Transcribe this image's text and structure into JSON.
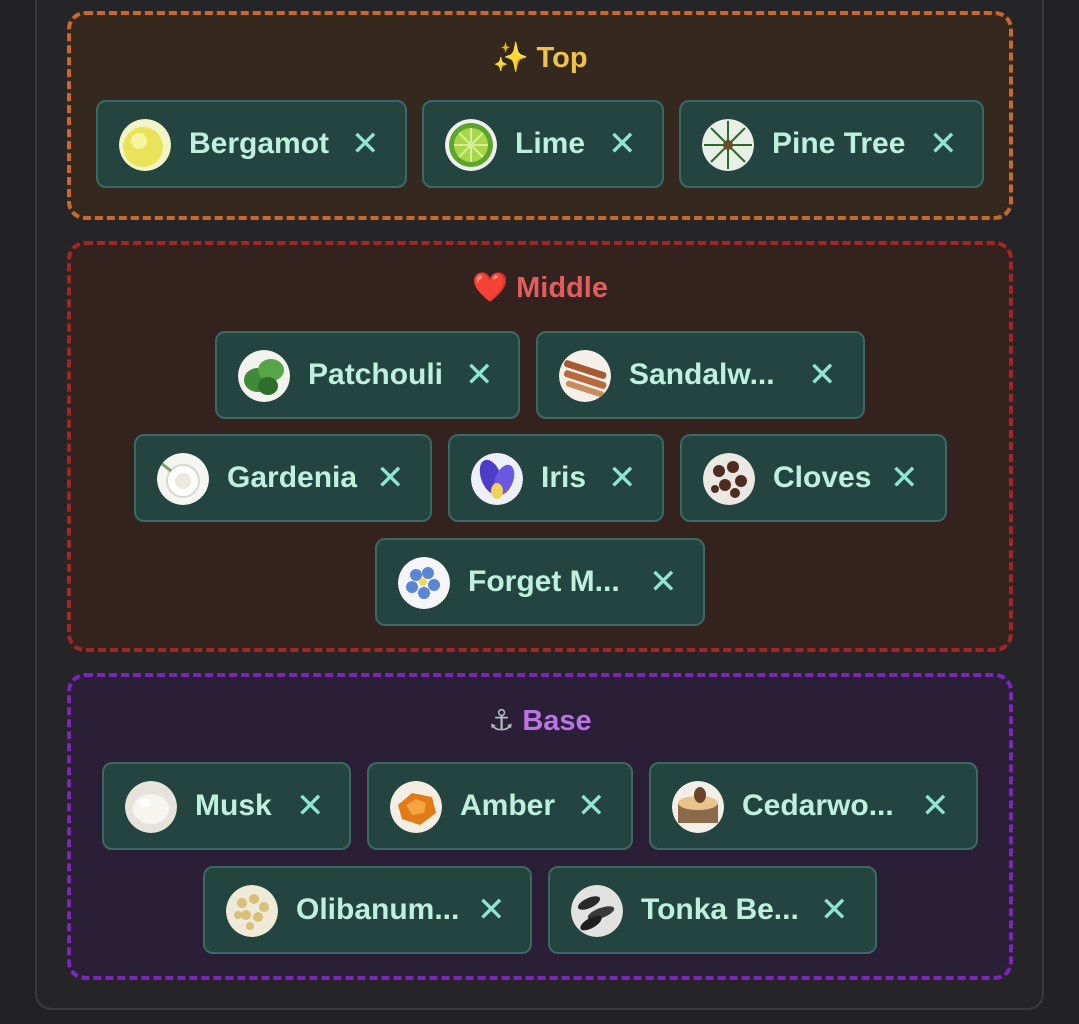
{
  "groups": {
    "top": {
      "emoji": "✨",
      "title": "Top",
      "chips": [
        {
          "label": "Bergamot",
          "icon": "bergamot-icon"
        },
        {
          "label": "Lime",
          "icon": "lime-icon"
        },
        {
          "label": "Pine Tree",
          "icon": "pine-tree-icon"
        }
      ]
    },
    "middle": {
      "emoji": "❤️",
      "title": "Middle",
      "chips": [
        {
          "label": "Patchouli",
          "icon": "patchouli-icon"
        },
        {
          "label": "Sandalw...",
          "icon": "sandalwood-icon"
        },
        {
          "label": "Gardenia",
          "icon": "gardenia-icon"
        },
        {
          "label": "Iris",
          "icon": "iris-icon"
        },
        {
          "label": "Cloves",
          "icon": "cloves-icon"
        },
        {
          "label": "Forget M...",
          "icon": "forget-me-not-icon"
        }
      ]
    },
    "base": {
      "emoji": "⚓",
      "title": "Base",
      "chips": [
        {
          "label": "Musk",
          "icon": "musk-icon"
        },
        {
          "label": "Amber",
          "icon": "amber-icon"
        },
        {
          "label": "Cedarwo...",
          "icon": "cedarwood-icon"
        },
        {
          "label": "Olibanum...",
          "icon": "olibanum-icon"
        },
        {
          "label": "Tonka Be...",
          "icon": "tonka-bean-icon"
        }
      ]
    }
  },
  "close_glyph": "✕"
}
